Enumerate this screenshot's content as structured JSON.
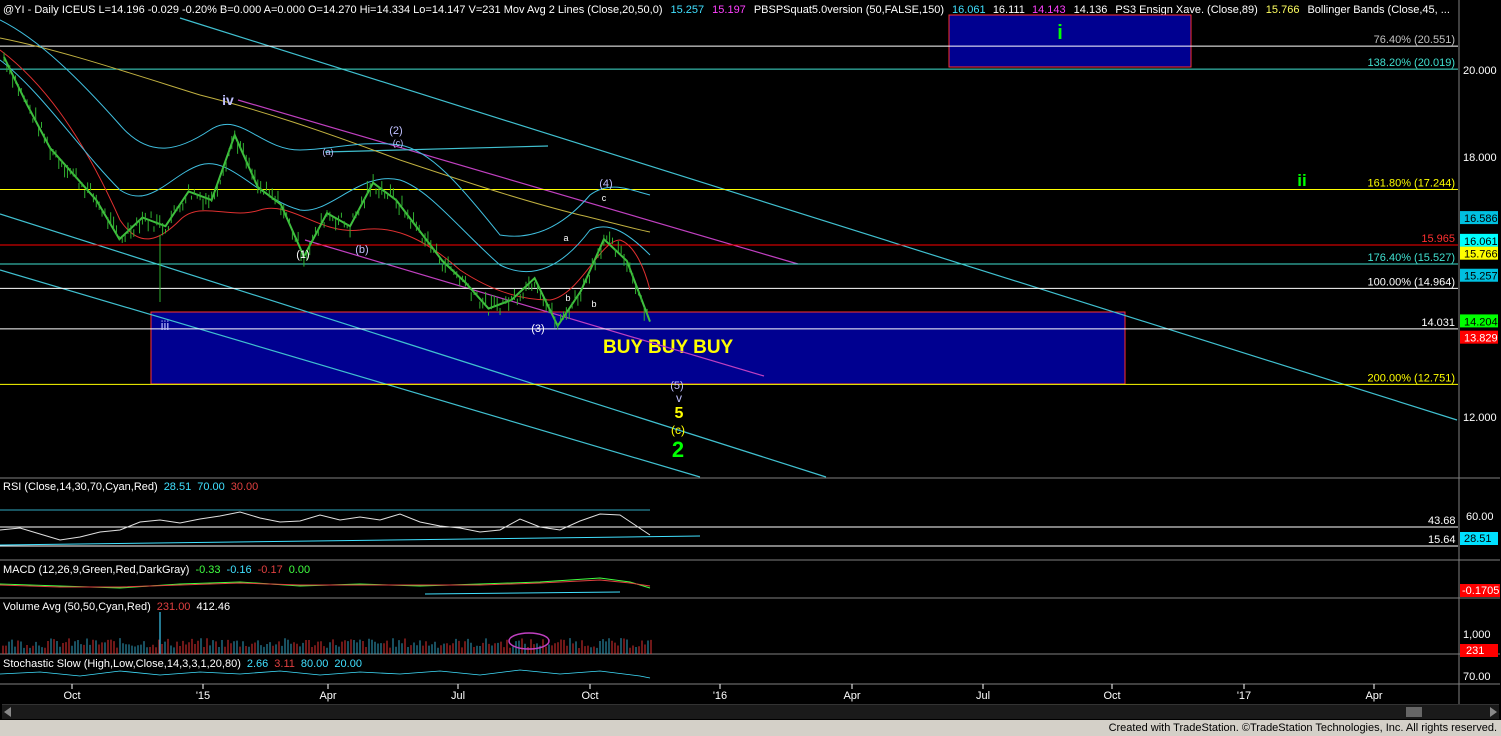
{
  "header": {
    "items": [
      {
        "text": "@YI - Daily  ICEUS  L=14.196  -0.029  -0.20%  B=0.000  A=0.000  O=14.270  Hi=14.334  Lo=14.147  V=231  Mov Avg 2 Lines (Close,20,50,0)",
        "color": "#ffffff"
      },
      {
        "text": "15.257",
        "color": "#40e0ff"
      },
      {
        "text": "15.197",
        "color": "#ff40ff"
      },
      {
        "text": "PBSPSquat5.0version (50,FALSE,150)",
        "color": "#ffffff"
      },
      {
        "text": "16.061",
        "color": "#40e0ff"
      },
      {
        "text": "16.111",
        "color": "#ffffff"
      },
      {
        "text": "14.143",
        "color": "#ff40ff"
      },
      {
        "text": "14.136",
        "color": "#ffffff"
      },
      {
        "text": "PS3 Ensign Xave. (Close,89)",
        "color": "#ffffff"
      },
      {
        "text": "15.766",
        "color": "#ffff60"
      },
      {
        "text": "Bollinger Bands (Close,45, ...",
        "color": "#ffffff"
      }
    ]
  },
  "price_axis": {
    "ticks": [
      {
        "value": 20,
        "label": "20.000"
      },
      {
        "value": 18,
        "label": "18.000"
      },
      {
        "value": 12,
        "label": "12.000"
      }
    ],
    "badges": [
      {
        "label": "16.586",
        "value": 16.586,
        "bg": "#00c0e0",
        "fg": "#000"
      },
      {
        "label": "16.061",
        "value": 16.061,
        "bg": "#00ffff",
        "fg": "#000"
      },
      {
        "label": "15.766",
        "value": 15.766,
        "bg": "#ffff00",
        "fg": "#000"
      },
      {
        "label": "15.257",
        "value": 15.257,
        "bg": "#00c0e0",
        "fg": "#000"
      },
      {
        "label": "14.204",
        "value": 14.204,
        "bg": "#00ff00",
        "fg": "#000"
      },
      {
        "label": "13.829",
        "value": 13.829,
        "bg": "#ff0000",
        "fg": "#fff"
      }
    ]
  },
  "levels": [
    {
      "label": "76.40% (20.551)",
      "value": 20.551,
      "color": "#ffffff",
      "label_color": "#c0c0c0"
    },
    {
      "label": "138.20% (20.019)",
      "value": 20.019,
      "color": "#40e0d0",
      "label_color": "#40e0d0"
    },
    {
      "label": "161.80% (17.244)",
      "value": 17.244,
      "color": "#ffff00",
      "label_color": "#ffff00"
    },
    {
      "label": "15.965",
      "value": 15.965,
      "color": "#ff0000",
      "label_color": "#ff3030"
    },
    {
      "label": "176.40% (15.527)",
      "value": 15.527,
      "color": "#40e0d0",
      "label_color": "#40e0d0"
    },
    {
      "label": "100.00% (14.964)",
      "value": 14.964,
      "color": "#ffffff",
      "label_color": "#ffffff"
    },
    {
      "label": "14.031",
      "value": 14.031,
      "color": "#ffffff",
      "label_color": "#ffffff"
    },
    {
      "label": "200.00% (12.751)",
      "value": 12.751,
      "color": "#ffff00",
      "label_color": "#ffff00"
    }
  ],
  "buy_box_label": "BUY BUY BUY",
  "wave_labels": [
    {
      "text": "iv",
      "color": "#c0c0ff"
    },
    {
      "text": "(2)",
      "color": "#c0c0ff"
    },
    {
      "text": "(c)",
      "color": "#c0c0ff"
    },
    {
      "text": "(a)",
      "color": "#c0c0ff"
    },
    {
      "text": "(1)",
      "color": "#ffffff"
    },
    {
      "text": "(b)",
      "color": "#c0c0ff"
    },
    {
      "text": "(3)",
      "color": "#ffffff"
    },
    {
      "text": "(4)",
      "color": "#c0c0ff"
    },
    {
      "text": "c",
      "color": "#ffffff"
    },
    {
      "text": "a",
      "color": "#ffffff"
    },
    {
      "text": "b",
      "color": "#ffffff"
    },
    {
      "text": "b",
      "color": "#ffffff"
    },
    {
      "text": "iii",
      "color": "#c0c0ff"
    },
    {
      "text": "(5)",
      "color": "#c0c0ff"
    },
    {
      "text": "v",
      "color": "#c0c0ff"
    },
    {
      "text": "5",
      "color": "#ffff00"
    },
    {
      "text": "(c)",
      "color": "#ffff00"
    },
    {
      "text": "2",
      "color": "#00ff00"
    },
    {
      "text": "i",
      "color": "#00ff00"
    },
    {
      "text": "ii",
      "color": "#00ff00"
    }
  ],
  "rsi": {
    "title": "RSI (Close,14,30,70,Cyan,Red)",
    "values": [
      "28.51",
      "70.00",
      "30.00"
    ],
    "tick_60": "60.00",
    "level_high": "43.68",
    "level_low": "15.64",
    "badge": "28.51"
  },
  "macd": {
    "title": "MACD (12,26,9,Green,Red,DarkGray)",
    "values": [
      "-0.33",
      "-0.16",
      "-0.17",
      "0.00"
    ],
    "badge": "-0.1705"
  },
  "volume": {
    "title": "Volume Avg (50,50,Cyan,Red)",
    "values": [
      "231.00",
      "412.46"
    ],
    "tick": "1,000",
    "badge": "231"
  },
  "stochastic": {
    "title": "Stochastic Slow (High,Low,Close,14,3,3,1,20,80)",
    "values": [
      "2.66",
      "3.11",
      "80.00",
      "20.00"
    ],
    "tick": "70.00"
  },
  "time_axis": [
    "Oct",
    "'15",
    "Apr",
    "Jul",
    "Oct",
    "'16",
    "Apr",
    "Jul",
    "Oct",
    "'17",
    "Apr"
  ],
  "footer": "Created with TradeStation. ©TradeStation Technologies, Inc. All rights reserved.",
  "chart_data": {
    "type": "line",
    "ylim": [
      11.4,
      21.1
    ],
    "price_series": [
      [
        "Aug '14",
        20.3
      ],
      [
        "Sep '14",
        19.2
      ],
      [
        "Sep '14",
        18.2
      ],
      [
        "Oct '14",
        17.6
      ],
      [
        "Oct '14",
        17.0
      ],
      [
        "Nov '14",
        16.1
      ],
      [
        "Nov '14",
        16.6
      ],
      [
        "Dec '14",
        16.4
      ],
      [
        "Jan '15",
        17.2
      ],
      [
        "Jan '15",
        17.0
      ],
      [
        "Feb '15",
        18.5
      ],
      [
        "Feb '15",
        17.3
      ],
      [
        "Mar '15",
        16.9
      ],
      [
        "Mar '15",
        15.7
      ],
      [
        "Apr '15",
        16.7
      ],
      [
        "Apr '15",
        16.4
      ],
      [
        "May '15",
        17.4
      ],
      [
        "May '15",
        17.0
      ],
      [
        "Jun '15",
        16.3
      ],
      [
        "Jun '15",
        15.6
      ],
      [
        "Jul '15",
        15.1
      ],
      [
        "Jul '15",
        14.5
      ],
      [
        "Aug '15",
        14.7
      ],
      [
        "Aug '15",
        15.2
      ],
      [
        "Sep '15",
        14.1
      ],
      [
        "Sep '15",
        14.9
      ],
      [
        "Oct '15",
        16.1
      ],
      [
        "Oct '15",
        15.6
      ],
      [
        "Nov '15",
        14.2
      ]
    ],
    "horizontal_levels": [
      20.551,
      20.019,
      17.244,
      15.965,
      15.527,
      14.964,
      14.031,
      12.751
    ],
    "buy_zone": [
      12.651,
      14.031
    ]
  }
}
